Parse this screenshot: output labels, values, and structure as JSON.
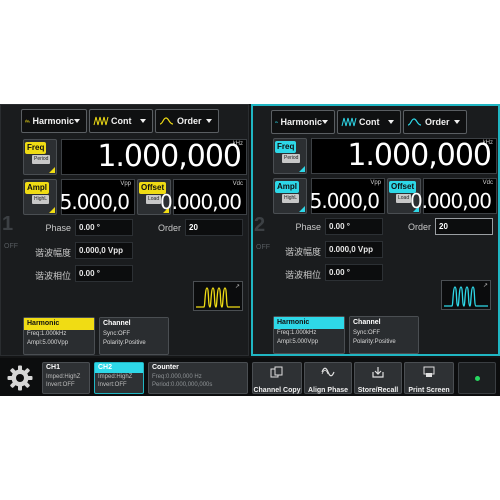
{
  "colors": {
    "ch1": "#f0dc14",
    "ch2": "#2ed8e8",
    "accent_border": "#20b6c3"
  },
  "ch1": {
    "number": "1",
    "state": "OFF",
    "dropdowns": [
      {
        "label": "Harmonic",
        "icon": "harmonic-wave-icon"
      },
      {
        "label": "Cont",
        "icon": "cont-wave-icon"
      },
      {
        "label": "Order",
        "icon": "order-wave-icon"
      }
    ],
    "freq": {
      "tag": "Freq",
      "sub": "Period",
      "value": "1.000,000",
      "unit": "kHz"
    },
    "ampl": {
      "tag": "Ampl",
      "sub": "HighL",
      "value": "5.000,0",
      "unit": "Vpp"
    },
    "offset": {
      "tag": "Offset",
      "sub": "Load",
      "value": "0.000,00",
      "unit": "Vdc"
    },
    "phase": {
      "label": "Phase",
      "value": "0.00 °"
    },
    "order": {
      "label": "Order",
      "value": "20"
    },
    "harm_ampl": {
      "label": "谐波幅度",
      "value": "0.000,0 Vpp"
    },
    "harm_phase": {
      "label": "谐波相位",
      "value": "0.00 °"
    },
    "card_harmonic": {
      "title": "Harmonic",
      "lines": [
        "Freq:1.000kHz",
        "Ampl:5.000Vpp"
      ]
    },
    "card_channel": {
      "title": "Channel",
      "lines": [
        "Sync:OFF",
        "Polarity:Positive"
      ]
    }
  },
  "ch2": {
    "number": "2",
    "state": "OFF",
    "dropdowns": [
      {
        "label": "Harmonic",
        "icon": "harmonic-wave-icon"
      },
      {
        "label": "Cont",
        "icon": "cont-wave-icon"
      },
      {
        "label": "Order",
        "icon": "order-wave-icon"
      }
    ],
    "freq": {
      "tag": "Freq",
      "sub": "Period",
      "value": "1.000,000",
      "unit": "kHz"
    },
    "ampl": {
      "tag": "Ampl",
      "sub": "HighL",
      "value": "5.000,0",
      "unit": "Vpp"
    },
    "offset": {
      "tag": "Offset",
      "sub": "Load",
      "value": "0.000,00",
      "unit": "Vdc"
    },
    "phase": {
      "label": "Phase",
      "value": "0.00 °"
    },
    "order": {
      "label": "Order",
      "value": "20"
    },
    "harm_ampl": {
      "label": "谐波幅度",
      "value": "0.000,0 Vpp"
    },
    "harm_phase": {
      "label": "谐波相位",
      "value": "0.00 °"
    },
    "card_harmonic": {
      "title": "Harmonic",
      "lines": [
        "Freq:1.000kHz",
        "Ampl:5.000Vpp"
      ]
    },
    "card_channel": {
      "title": "Channel",
      "lines": [
        "Sync:OFF",
        "Polarity:Positive"
      ]
    }
  },
  "bottom": {
    "ch1": {
      "title": "CH1",
      "lines": [
        "Imped:HighZ",
        "Invert:OFF"
      ]
    },
    "ch2": {
      "title": "CH2",
      "lines": [
        "Imped:HighZ",
        "Invert:OFF"
      ]
    },
    "counter": {
      "title": "Counter",
      "lines": [
        "Freq:0.000,000 Hz",
        "Period:0.000,000,000s"
      ]
    },
    "buttons": [
      {
        "label": "Channel Copy",
        "icon": "channel-copy-icon"
      },
      {
        "label": "Align Phase",
        "icon": "align-phase-icon"
      },
      {
        "label": "Store/Recall",
        "icon": "store-recall-icon"
      },
      {
        "label": "Print Screen",
        "icon": "print-screen-icon"
      }
    ],
    "local_icon": "locate-icon"
  }
}
